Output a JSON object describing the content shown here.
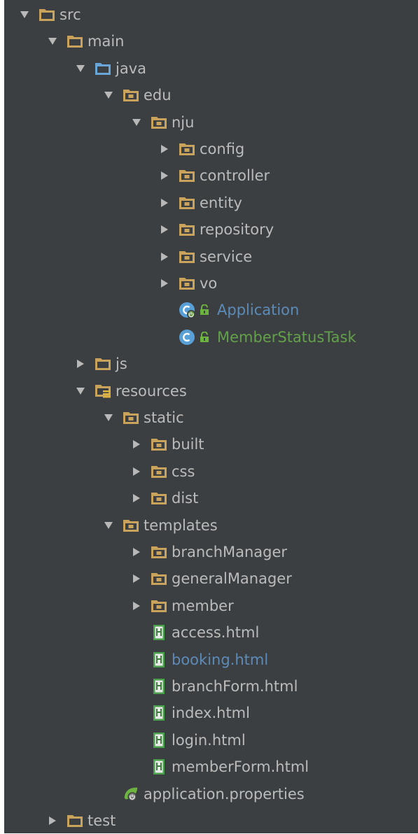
{
  "colors": {
    "background": "#3c3f41",
    "text": "#bbbbbb",
    "folder": "#c9a35c",
    "source_root_folder": "#6aa5d8",
    "class_blue_text": "#5d8bb8",
    "class_green_text": "#62a14a"
  },
  "tree": [
    {
      "label": "src",
      "depth": 0,
      "expanded": true,
      "icon": "folder-icon"
    },
    {
      "label": "main",
      "depth": 1,
      "expanded": true,
      "icon": "folder-icon"
    },
    {
      "label": "java",
      "depth": 2,
      "expanded": true,
      "icon": "source-folder-icon"
    },
    {
      "label": "edu",
      "depth": 3,
      "expanded": true,
      "icon": "package-icon"
    },
    {
      "label": "nju",
      "depth": 4,
      "expanded": true,
      "icon": "package-icon"
    },
    {
      "label": "config",
      "depth": 5,
      "expanded": false,
      "icon": "package-icon"
    },
    {
      "label": "controller",
      "depth": 5,
      "expanded": false,
      "icon": "package-icon"
    },
    {
      "label": "entity",
      "depth": 5,
      "expanded": false,
      "icon": "package-icon"
    },
    {
      "label": "repository",
      "depth": 5,
      "expanded": false,
      "icon": "package-icon"
    },
    {
      "label": "service",
      "depth": 5,
      "expanded": false,
      "icon": "package-icon"
    },
    {
      "label": "vo",
      "depth": 5,
      "expanded": false,
      "icon": "package-icon"
    },
    {
      "label": "Application",
      "depth": 5,
      "expanded": null,
      "icon": "spring-boot-class-icon",
      "lock": true,
      "color": "blue"
    },
    {
      "label": "MemberStatusTask",
      "depth": 5,
      "expanded": null,
      "icon": "class-icon",
      "lock": true,
      "color": "green"
    },
    {
      "label": "js",
      "depth": 2,
      "expanded": false,
      "icon": "folder-icon"
    },
    {
      "label": "resources",
      "depth": 2,
      "expanded": true,
      "icon": "resources-folder-icon"
    },
    {
      "label": "static",
      "depth": 3,
      "expanded": true,
      "icon": "package-icon"
    },
    {
      "label": "built",
      "depth": 4,
      "expanded": false,
      "icon": "package-icon"
    },
    {
      "label": "css",
      "depth": 4,
      "expanded": false,
      "icon": "package-icon"
    },
    {
      "label": "dist",
      "depth": 4,
      "expanded": false,
      "icon": "package-icon"
    },
    {
      "label": "templates",
      "depth": 3,
      "expanded": true,
      "icon": "package-icon"
    },
    {
      "label": "branchManager",
      "depth": 4,
      "expanded": false,
      "icon": "package-icon"
    },
    {
      "label": "generalManager",
      "depth": 4,
      "expanded": false,
      "icon": "package-icon"
    },
    {
      "label": "member",
      "depth": 4,
      "expanded": false,
      "icon": "package-icon"
    },
    {
      "label": "access.html",
      "depth": 4,
      "expanded": null,
      "icon": "html-file-icon"
    },
    {
      "label": "booking.html",
      "depth": 4,
      "expanded": null,
      "icon": "html-file-icon",
      "color": "blue"
    },
    {
      "label": "branchForm.html",
      "depth": 4,
      "expanded": null,
      "icon": "html-file-icon"
    },
    {
      "label": "index.html",
      "depth": 4,
      "expanded": null,
      "icon": "html-file-icon"
    },
    {
      "label": "login.html",
      "depth": 4,
      "expanded": null,
      "icon": "html-file-icon"
    },
    {
      "label": "memberForm.html",
      "depth": 4,
      "expanded": null,
      "icon": "html-file-icon"
    },
    {
      "label": "application.properties",
      "depth": 3,
      "expanded": null,
      "icon": "spring-properties-icon"
    },
    {
      "label": "test",
      "depth": 1,
      "expanded": false,
      "icon": "folder-icon"
    }
  ]
}
